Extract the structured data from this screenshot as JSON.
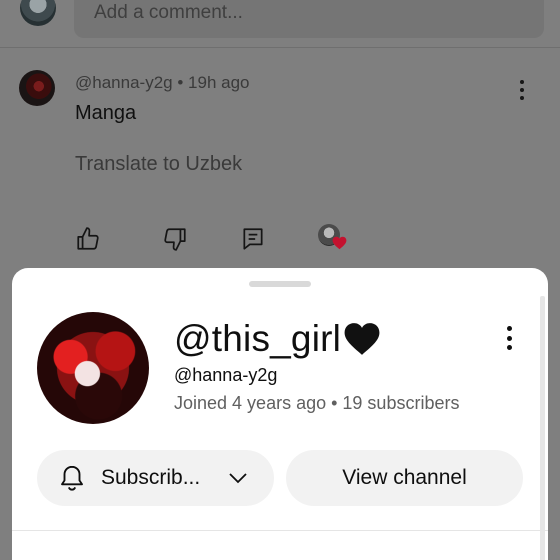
{
  "comment_input": {
    "placeholder": "Add a comment..."
  },
  "comment": {
    "author": "@hanna-y2g",
    "separator": "•",
    "time": "19h ago",
    "text": "Manga",
    "translate": "Translate to Uzbek",
    "actions": [
      "thumbs-up-icon",
      "thumbs-down-icon",
      "reply-icon",
      "creator-heart-icon"
    ]
  },
  "sheet": {
    "channel_name": "@this_girl",
    "channel_emoji": "black-heart-icon",
    "handle": "@hanna-y2g",
    "stats": "Joined 4 years ago • 19 subscribers",
    "subscribe_label": "Subscrib...",
    "view_channel_label": "View channel"
  },
  "colors": {
    "overlay_gray": "#7f7f7f",
    "sheet_bg": "#ffffff",
    "button_bg": "#f2f2f2",
    "heart_red": "#c4122f"
  }
}
